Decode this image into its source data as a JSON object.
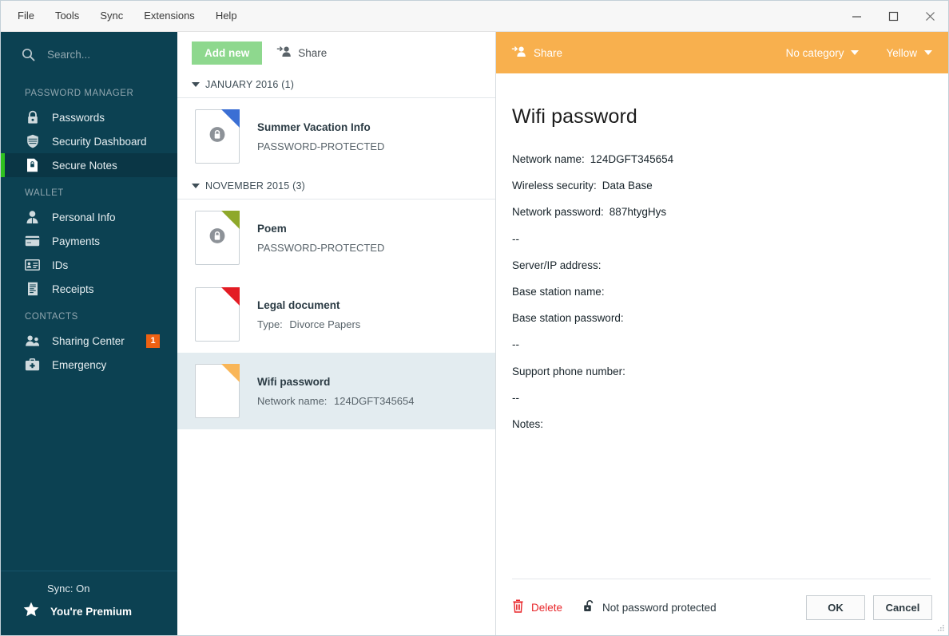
{
  "app": {
    "menu": [
      "File",
      "Tools",
      "Sync",
      "Extensions",
      "Help"
    ],
    "window_controls": {
      "minimize": "minimize-icon",
      "maximize": "maximize-icon",
      "close": "close-icon"
    }
  },
  "sidebar": {
    "search": {
      "value": "",
      "placeholder": "Search..."
    },
    "sections": [
      {
        "title": "PASSWORD MANAGER",
        "items": [
          {
            "label": "Passwords",
            "icon": "lock-icon",
            "active": false,
            "badge": ""
          },
          {
            "label": "Security Dashboard",
            "icon": "shield-icon",
            "active": false,
            "badge": ""
          },
          {
            "label": "Secure Notes",
            "icon": "secure-note-icon",
            "active": true,
            "badge": ""
          }
        ]
      },
      {
        "title": "WALLET",
        "items": [
          {
            "label": "Personal Info",
            "icon": "person-icon",
            "active": false,
            "badge": ""
          },
          {
            "label": "Payments",
            "icon": "credit-card-icon",
            "active": false,
            "badge": ""
          },
          {
            "label": "IDs",
            "icon": "id-card-icon",
            "active": false,
            "badge": ""
          },
          {
            "label": "Receipts",
            "icon": "receipt-icon",
            "active": false,
            "badge": ""
          }
        ]
      },
      {
        "title": "CONTACTS",
        "items": [
          {
            "label": "Sharing Center",
            "icon": "people-icon",
            "active": false,
            "badge": "1"
          },
          {
            "label": "Emergency",
            "icon": "first-aid-icon",
            "active": false,
            "badge": ""
          }
        ]
      }
    ],
    "footer": {
      "sync_status": "Sync: On",
      "premium_label": "You're Premium",
      "premium_icon": "star-icon"
    },
    "colors": {
      "background": "#0c4152",
      "active_background": "#0a3645",
      "active_indicator": "#2fc21f",
      "badge": "#ee6112"
    }
  },
  "list_panel": {
    "toolbar": {
      "add_new_label": "Add new",
      "add_new_color": "#8ed88e",
      "share_label": "Share",
      "share_icon": "share-person-icon"
    },
    "groups": [
      {
        "header": "JANUARY 2016 (1)",
        "items": [
          {
            "title": "Summer Vacation Info",
            "subtitle_key": "PASSWORD-PROTECTED",
            "subtitle_value": "",
            "fold_color": "#3b6fd4",
            "locked": true,
            "selected": false
          }
        ]
      },
      {
        "header": "NOVEMBER 2015 (3)",
        "items": [
          {
            "title": "Poem",
            "subtitle_key": "PASSWORD-PROTECTED",
            "subtitle_value": "",
            "fold_color": "#8ea82a",
            "locked": true,
            "selected": false
          },
          {
            "title": "Legal document",
            "subtitle_key": "Type:",
            "subtitle_value": "Divorce Papers",
            "fold_color": "#e31c24",
            "locked": false,
            "selected": false
          },
          {
            "title": "Wifi password",
            "subtitle_key": "Network name:",
            "subtitle_value": "124DGFT345654",
            "fold_color": "#f9b658",
            "locked": false,
            "selected": true
          }
        ]
      }
    ]
  },
  "detail": {
    "header": {
      "background": "#f8b04e",
      "share_label": "Share",
      "share_icon": "share-person-icon",
      "category_label": "No category",
      "color_label": "Yellow"
    },
    "title": "Wifi password",
    "fields": [
      {
        "key": "Network name:",
        "value": "124DGFT345654"
      },
      {
        "key": "Wireless security:",
        "value": "Data Base"
      },
      {
        "key": "Network password:",
        "value": "887htygHys"
      },
      {
        "key": "--",
        "value": ""
      },
      {
        "key": "Server/IP address:",
        "value": ""
      },
      {
        "key": "Base station name:",
        "value": ""
      },
      {
        "key": "Base station password:",
        "value": ""
      },
      {
        "key": "--",
        "value": ""
      },
      {
        "key": "Support phone number:",
        "value": ""
      },
      {
        "key": "--",
        "value": ""
      },
      {
        "key": "Notes:",
        "value": ""
      }
    ],
    "footer": {
      "delete_label": "Delete",
      "delete_icon": "trash-icon",
      "delete_color": "#e8262a",
      "protection_label": "Not password protected",
      "protection_icon": "unlocked-padlock-icon",
      "ok_label": "OK",
      "cancel_label": "Cancel"
    }
  }
}
